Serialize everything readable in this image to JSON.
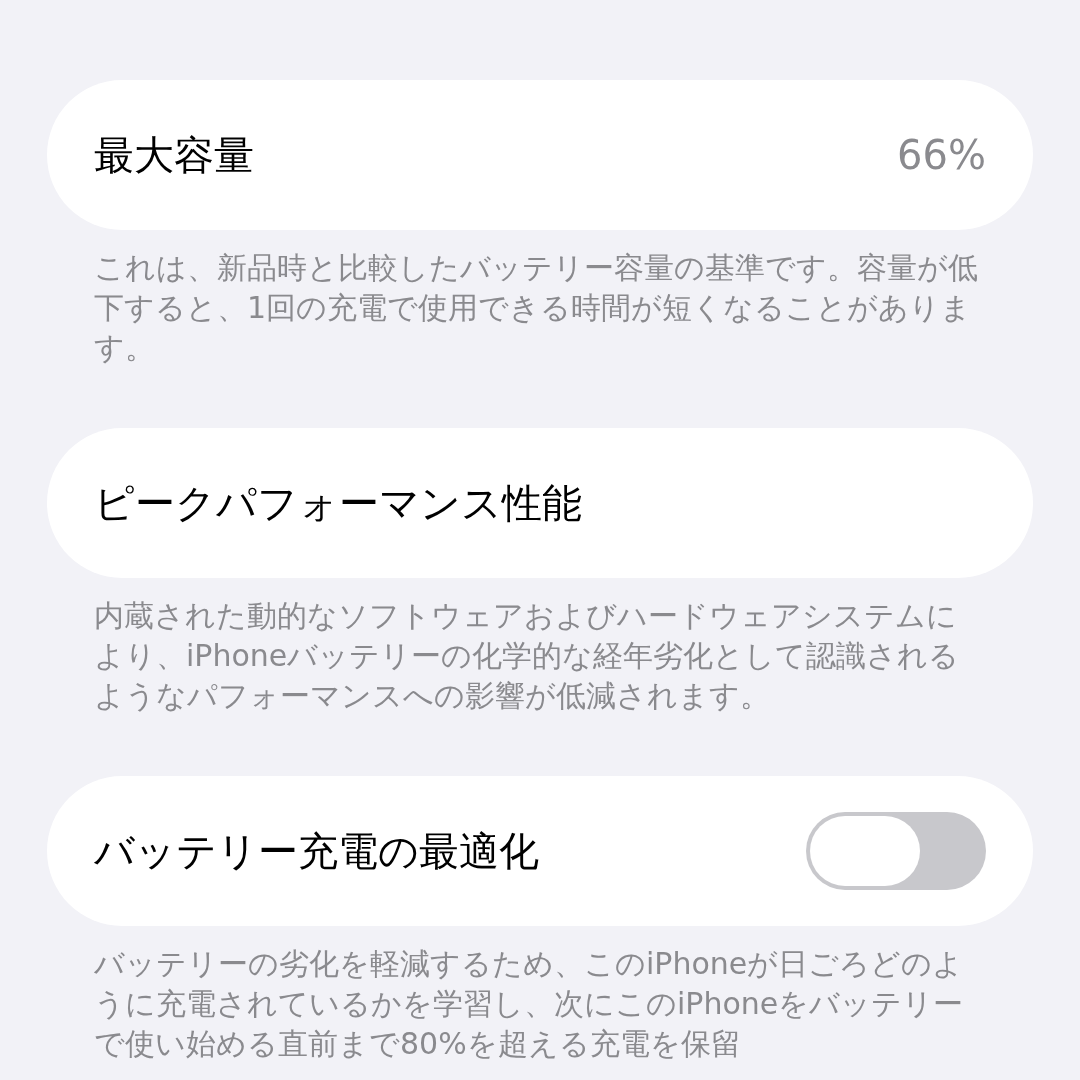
{
  "sections": [
    {
      "kind": "value",
      "title": "最大容量",
      "value": "66%",
      "footer": "これは、新品時と比較したバッテリー容量の基準です。容量が低下すると、1回の充電で使用できる時間が短くなることがあります。"
    },
    {
      "kind": "plain",
      "title": "ピークパフォーマンス性能",
      "footer": "内蔵された動的なソフトウェアおよびハードウェアシステムにより、iPhoneバッテリーの化学的な経年劣化として認識されるようなパフォーマンスへの影響が低減されます。"
    },
    {
      "kind": "toggle",
      "title": "バッテリー充電の最適化",
      "on": false,
      "footer": "バッテリーの劣化を軽減するため、このiPhoneが日ごろどのように充電されているかを学習し、次にこのiPhoneをバッテリーで使い始める直前まで80%を超える充電を保留"
    }
  ]
}
